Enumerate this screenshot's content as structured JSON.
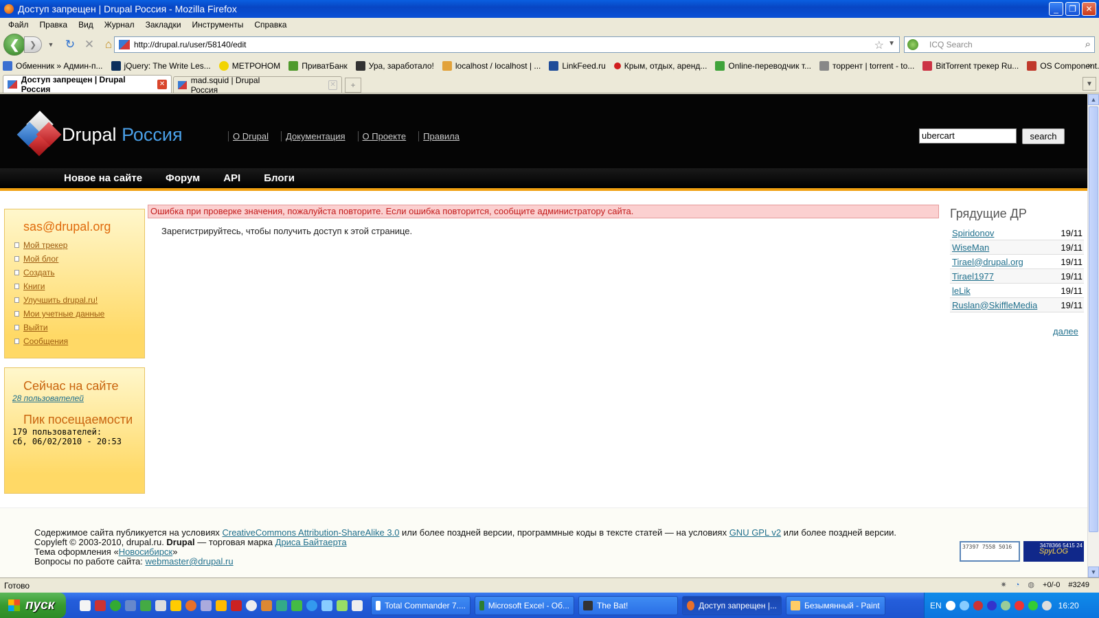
{
  "window": {
    "title": "Доступ запрещен | Drupal Россия - Mozilla Firefox"
  },
  "menu": [
    "Файл",
    "Правка",
    "Вид",
    "Журнал",
    "Закладки",
    "Инструменты",
    "Справка"
  ],
  "nav": {
    "url": "http://drupal.ru/user/58140/edit",
    "search_placeholder": "ICQ Search"
  },
  "bookmarks": [
    {
      "label": "Обменник » Админ-п...",
      "color": "#3b6fd1"
    },
    {
      "label": "jQuery: The Write Les...",
      "color": "#0c2f5c"
    },
    {
      "label": "МЕТРОНОМ",
      "color": "#f2d400"
    },
    {
      "label": "ПриватБанк",
      "color": "#4f9a2c"
    },
    {
      "label": "Ура, заработало!",
      "color": "#333333"
    },
    {
      "label": "localhost / localhost | ...",
      "color": "#e2a23a"
    },
    {
      "label": "LinkFeed.ru",
      "color": "#1f4c99"
    },
    {
      "label": "Крым, отдых, аренд...",
      "color": "#d11e1e"
    },
    {
      "label": "Online-переводчик т...",
      "color": "#3fa33a"
    },
    {
      "label": "торрент | torrent - to...",
      "color": "#888888"
    },
    {
      "label": "BitTorrent трекер Ru...",
      "color": "#cc3344"
    },
    {
      "label": "OS Component. Инте...",
      "color": "#c0392b"
    }
  ],
  "tabs": [
    {
      "label": "Доступ запрещен | Drupal Россия"
    },
    {
      "label": "mad.squid | Drupal Россия"
    }
  ],
  "site": {
    "brand_a": "Drupal",
    "brand_b": "Россия",
    "topnav": [
      "О Drupal",
      "Документация",
      "О Проекте",
      "Правила"
    ],
    "search_value": "ubercart",
    "search_button": "search",
    "mainnav": [
      "Новое на сайте",
      "Форум",
      "API",
      "Блоги"
    ]
  },
  "userbox": {
    "title": "sas@drupal.org",
    "links": [
      "Мой трекер",
      "Мой блог",
      "Создать",
      "Книги",
      "Улучшить drupal.ru!",
      "Мои учетные данные",
      "Выйти",
      "Сообщения"
    ]
  },
  "online": {
    "title": "Сейчас на сайте",
    "users_link": "28 пользователей",
    "peak_title": "Пик посещаемости",
    "peak_line1": "179 пользователей:",
    "peak_line2": "сб, 06/02/2010 - 20:53"
  },
  "error": "Ошибка при проверке значения, пожалуйста повторите. Если ошибка повторится, сообщите администратору сайта.",
  "message": "Зарегистрируйтесь, чтобы получить доступ к этой странице.",
  "birthdays": {
    "title": "Грядущие ДР",
    "rows": [
      {
        "name": "Spiridonov",
        "date": "19/11"
      },
      {
        "name": "WiseMan",
        "date": "19/11"
      },
      {
        "name": "Tirael@drupal.org",
        "date": "19/11"
      },
      {
        "name": "Tirael1977",
        "date": "19/11"
      },
      {
        "name": "leLik",
        "date": "19/11"
      },
      {
        "name": "Ruslan@SkiffleMedia",
        "date": "19/11"
      }
    ],
    "more": "далее"
  },
  "footer": {
    "l1a": "Содержимое сайта публикуется на условиях ",
    "l1link": "CreativeCommons Attribution-ShareAlike 3.0",
    "l1b": " или более поздней версии, программные коды в тексте статей — на условиях ",
    "l1link2": "GNU GPL v2",
    "l1c": " или более поздней версии.",
    "l2a": "Copyleft © 2003-2010, drupal.ru. ",
    "l2b": "Drupal",
    "l2c": " — торговая марка ",
    "l2link": "Дриса Байтаерта",
    "l3a": "Тема оформления «",
    "l3link": "Новосибирск",
    "l3b": "»",
    "l4a": "Вопросы по работе сайта: ",
    "l4link": "webmaster@drupal.ru",
    "counter1": "37397 7558 5016",
    "counter2_brand": "SpyLOG",
    "counter2_nums": "3478366 5415 24"
  },
  "status": {
    "text": "Готово",
    "right_a": "+0/-0",
    "right_b": "#3249"
  },
  "taskbar": {
    "start": "пуск",
    "tasks": [
      "Total Commander 7....",
      "Microsoft Excel - Об...",
      "The Bat!",
      "Доступ запрещен |...",
      "Безымянный - Paint"
    ],
    "lang": "EN",
    "clock": "16:20"
  }
}
